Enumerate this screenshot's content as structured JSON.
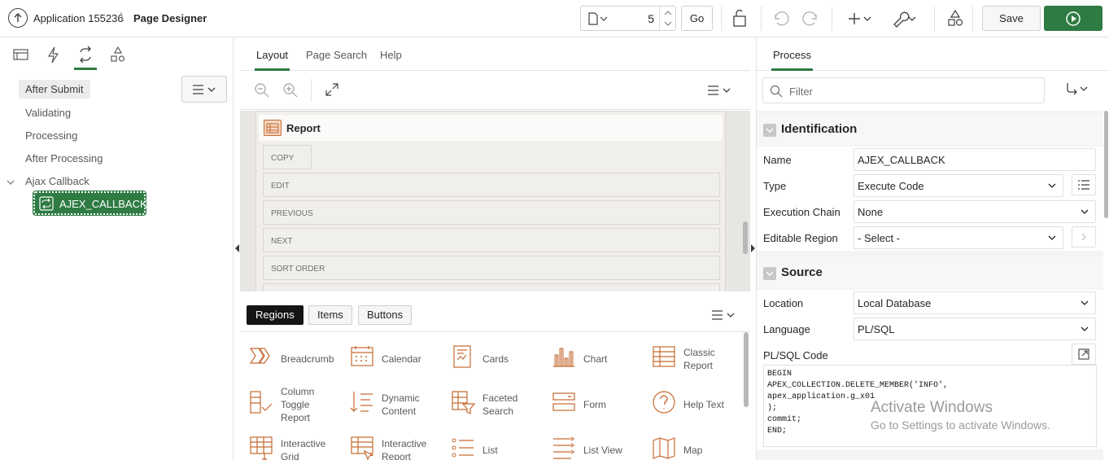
{
  "header": {
    "app_title": "Application 155236",
    "separator": "\\",
    "page_title": "Page Designer",
    "page_number": "5",
    "go_label": "Go",
    "save_label": "Save"
  },
  "left_panel": {
    "tabs": [
      "rendering",
      "dynamic-actions",
      "processing",
      "shared-components"
    ],
    "active_tab": "processing",
    "tree": {
      "after_submit": "After Submit",
      "validating": "Validating",
      "processing": "Processing",
      "after_processing": "After Processing",
      "ajax_callback": "Ajax Callback",
      "ajax_node": "AJEX_CALLBACK"
    }
  },
  "center_panel": {
    "tabs": [
      "Layout",
      "Page Search",
      "Help"
    ],
    "active_tab": "Layout",
    "region_title": "Report",
    "slots": [
      "COPY",
      "EDIT",
      "PREVIOUS",
      "NEXT",
      "SORT ORDER"
    ],
    "gallery_tabs": [
      "Regions",
      "Items",
      "Buttons"
    ],
    "active_gallery_tab": "Regions",
    "gallery_items": [
      [
        "Breadcrumb"
      ],
      [
        "Calendar"
      ],
      [
        "Cards"
      ],
      [
        "Chart"
      ],
      [
        "Classic",
        "Report"
      ],
      [
        "Column",
        "Toggle",
        "Report"
      ],
      [
        "Dynamic",
        "Content"
      ],
      [
        "Faceted",
        "Search"
      ],
      [
        "Form"
      ],
      [
        "Help Text"
      ],
      [
        "Interactive",
        "Grid"
      ],
      [
        "Interactive",
        "Report"
      ],
      [
        "List"
      ],
      [
        "List View"
      ],
      [
        "Map"
      ]
    ]
  },
  "right_panel": {
    "tab": "Process",
    "filter_placeholder": "Filter",
    "identification": {
      "title": "Identification",
      "name_label": "Name",
      "name_value": "AJEX_CALLBACK",
      "type_label": "Type",
      "type_value": "Execute Code",
      "chain_label": "Execution Chain",
      "chain_value": "None",
      "region_label": "Editable Region",
      "region_value": "- Select -"
    },
    "source": {
      "title": "Source",
      "location_label": "Location",
      "location_value": "Local Database",
      "language_label": "Language",
      "language_value": "PL/SQL",
      "code_label": "PL/SQL Code",
      "code": "BEGIN\nAPEX_COLLECTION.DELETE_MEMBER('INFO',\napex_application.g_x01\n);\ncommit;\nEND;"
    }
  },
  "watermark": {
    "line1": "Activate Windows",
    "line2": "Go to Settings to activate Windows."
  },
  "colors": {
    "accent_green": "#2e7b43",
    "orange_icon": "#c66a31"
  }
}
